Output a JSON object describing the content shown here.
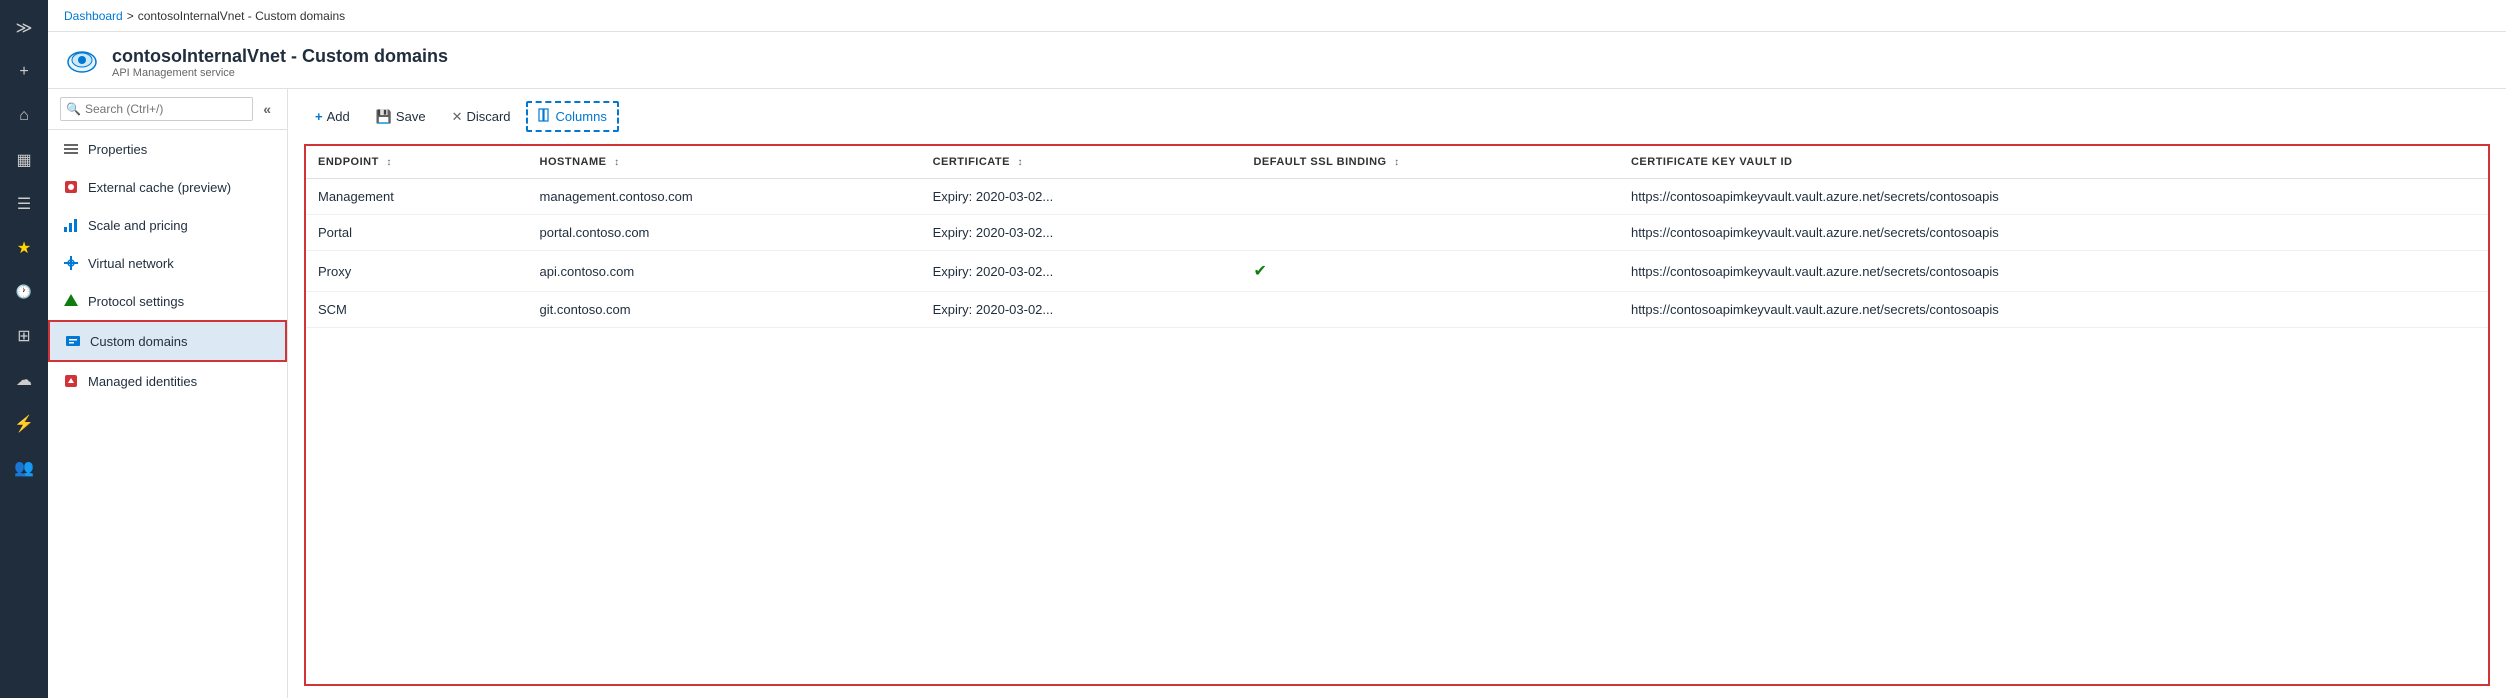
{
  "iconBar": {
    "items": [
      {
        "name": "collapse-icon",
        "symbol": "≫",
        "interactable": true
      },
      {
        "name": "plus-icon",
        "symbol": "+",
        "interactable": true
      },
      {
        "name": "home-icon",
        "symbol": "⌂",
        "interactable": true
      },
      {
        "name": "dashboard-icon",
        "symbol": "▦",
        "interactable": true
      },
      {
        "name": "list-icon",
        "symbol": "☰",
        "interactable": true
      },
      {
        "name": "star-icon",
        "symbol": "★",
        "interactable": true
      },
      {
        "name": "clock-icon",
        "symbol": "🕐",
        "interactable": true
      },
      {
        "name": "grid-icon",
        "symbol": "⊞",
        "interactable": true
      },
      {
        "name": "cloud-icon",
        "symbol": "☁",
        "interactable": true
      },
      {
        "name": "lightning-icon",
        "symbol": "⚡",
        "interactable": true
      },
      {
        "name": "people-icon",
        "symbol": "👥",
        "interactable": true
      }
    ]
  },
  "breadcrumb": {
    "home": "Dashboard",
    "separator": ">",
    "current": "contosoInternalVnet - Custom domains"
  },
  "header": {
    "title": "contosoInternalVnet - Custom domains",
    "subtitle": "API Management service"
  },
  "sidebar": {
    "search_placeholder": "Search (Ctrl+/)",
    "collapse_title": "«",
    "items": [
      {
        "id": "properties",
        "label": "Properties",
        "icon": "≡≡≡",
        "active": false
      },
      {
        "id": "external-cache",
        "label": "External cache (preview)",
        "icon": "🔴",
        "active": false
      },
      {
        "id": "scale-pricing",
        "label": "Scale and pricing",
        "icon": "✏",
        "active": false
      },
      {
        "id": "virtual-network",
        "label": "Virtual network",
        "icon": "↔",
        "active": false
      },
      {
        "id": "protocol-settings",
        "label": "Protocol settings",
        "icon": "🛡",
        "active": false
      },
      {
        "id": "custom-domains",
        "label": "Custom domains",
        "icon": "🖥",
        "active": true
      },
      {
        "id": "managed-identities",
        "label": "Managed identities",
        "icon": "🔒",
        "active": false
      }
    ]
  },
  "toolbar": {
    "add_label": "Add",
    "save_label": "Save",
    "discard_label": "Discard",
    "columns_label": "Columns"
  },
  "table": {
    "columns": [
      {
        "id": "endpoint",
        "label": "ENDPOINT"
      },
      {
        "id": "hostname",
        "label": "HOSTNAME"
      },
      {
        "id": "certificate",
        "label": "CERTIFICATE"
      },
      {
        "id": "default_ssl",
        "label": "DEFAULT SSL BINDING"
      },
      {
        "id": "cert_keyvault",
        "label": "CERTIFICATE KEY VAULT ID"
      }
    ],
    "rows": [
      {
        "endpoint": "Management",
        "hostname": "management.contoso.com",
        "certificate": "Expiry: 2020-03-02...",
        "default_ssl": "",
        "cert_keyvault": "https://contosoapimkeyvault.vault.azure.net/secrets/contosoapis"
      },
      {
        "endpoint": "Portal",
        "hostname": "portal.contoso.com",
        "certificate": "Expiry: 2020-03-02...",
        "default_ssl": "",
        "cert_keyvault": "https://contosoapimkeyvault.vault.azure.net/secrets/contosoapis"
      },
      {
        "endpoint": "Proxy",
        "hostname": "api.contoso.com",
        "certificate": "Expiry: 2020-03-02...",
        "default_ssl": "✓",
        "cert_keyvault": "https://contosoapimkeyvault.vault.azure.net/secrets/contosoapis"
      },
      {
        "endpoint": "SCM",
        "hostname": "git.contoso.com",
        "certificate": "Expiry: 2020-03-02...",
        "default_ssl": "",
        "cert_keyvault": "https://contosoapimkeyvault.vault.azure.net/secrets/contosoapis"
      }
    ]
  }
}
